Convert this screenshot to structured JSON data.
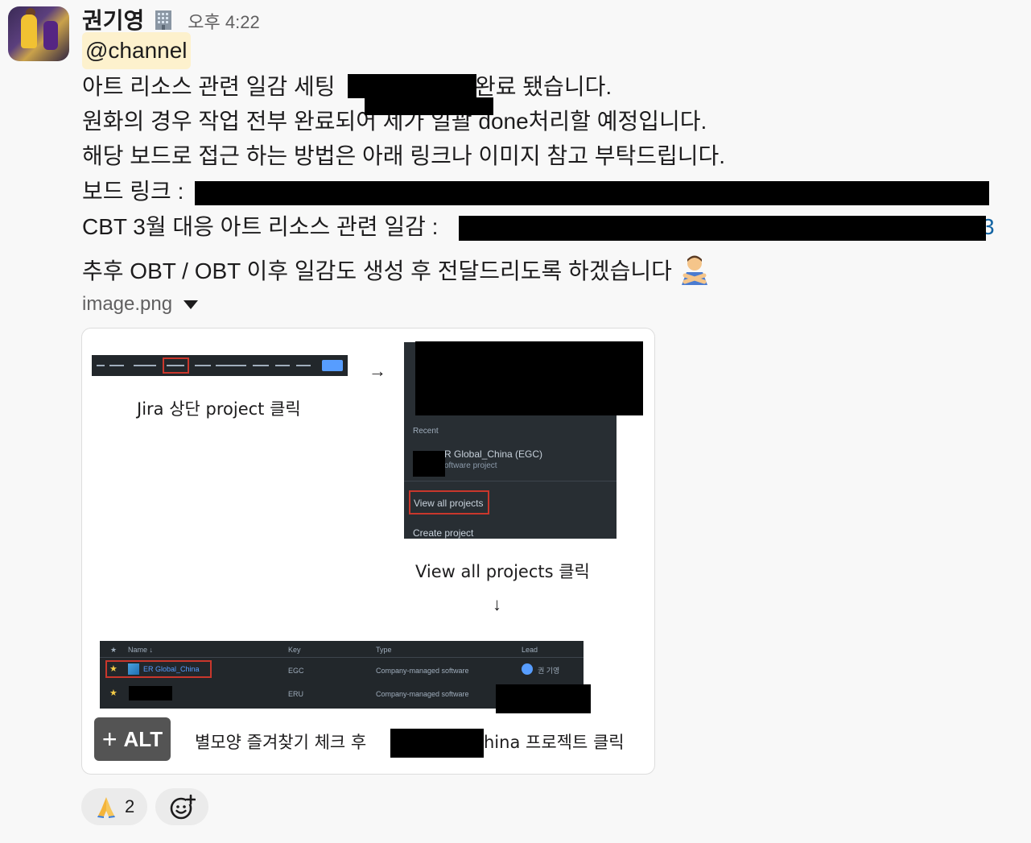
{
  "author": {
    "name": "권기영",
    "status_icon": "office-building-icon"
  },
  "timestamp": "오후 4:22",
  "mention": "@channel",
  "message_lines": [
    "아트 리소스 관련 일감 세팅",
    "완료 됐습니다.",
    "원화의 경우 작업 전부 완료되어 제가 일괄 done처리할 예정입니다.",
    "해당 보드로 접근 하는 방법은 아래 링크나 이미지 참고 부탁드립니다.",
    "보드 링크 :",
    "CBT 3월 대응 아트 리소스 관련 일감 :",
    "3",
    "추후 OBT / OBT 이후 일감도 생성 후 전달드리도록 하겠습니다"
  ],
  "attachment": {
    "filename": "image.png",
    "caption_1": "Jira 상단 project 클릭",
    "arrow_right": "→",
    "arrow_down": "↓",
    "caption_2": "View all projects 클릭",
    "caption_3_left": "별모양 즐겨찾기 체크 후",
    "caption_3_right": "hina 프로젝트 클릭",
    "alt_label": "ALT",
    "menu": {
      "recent": "Recent",
      "project_name": "R Global_China (EGC)",
      "project_sub": "oftware project",
      "view_all": "View all projects",
      "create": "Create project"
    },
    "table": {
      "headers": [
        "Name ↓",
        "Key",
        "Type",
        "Lead"
      ],
      "rows": [
        {
          "name": "ER Global_China",
          "key": "EGC",
          "type": "Company-managed software",
          "lead": "권 기영"
        },
        {
          "name": "",
          "key": "ERU",
          "type": "Company-managed software",
          "lead": ""
        }
      ]
    }
  },
  "reactions": [
    {
      "emoji": "folded-hands-icon",
      "count": "2"
    }
  ],
  "colors": {
    "mention_bg": "#fdf1cd",
    "link": "#1264a3",
    "highlight_red": "#c9372c"
  }
}
